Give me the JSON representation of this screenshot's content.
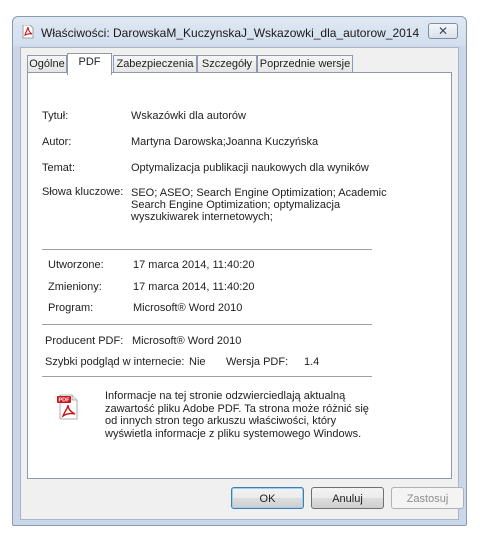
{
  "window": {
    "title": "Właściwości: DarowskaM_KuczynskaJ_Wskazowki_dla_autorow_2014",
    "close_glyph": "✕",
    "icon": "pdf-file-icon"
  },
  "tabs": [
    {
      "label": "Ogólne",
      "active": false
    },
    {
      "label": "PDF",
      "active": true
    },
    {
      "label": "Zabezpieczenia",
      "active": false
    },
    {
      "label": "Szczegóły",
      "active": false
    },
    {
      "label": "Poprzednie wersje",
      "active": false
    }
  ],
  "properties": {
    "title_label": "Tytuł:",
    "title_value": "Wskazówki dla autorów",
    "author_label": "Autor:",
    "author_value": "Martyna Darowska;Joanna Kuczyńska",
    "subject_label": "Temat:",
    "subject_value": "Optymalizacja publikacji naukowych dla wyników",
    "keywords_label": "Słowa kluczowe:",
    "keywords_value": "SEO; ASEO; Search Engine Optimization; Academic Search Engine Optimization; optymalizacja wyszukiwarek internetowych;"
  },
  "dates": {
    "created_label": "Utworzone:",
    "created_value": "17 marca 2014, 11:40:20",
    "modified_label": "Zmieniony:",
    "modified_value": "17 marca 2014, 11:40:20",
    "program_label": "Program:",
    "program_value": "Microsoft® Word 2010"
  },
  "producer": {
    "label": "Producent PDF:",
    "value": "Microsoft® Word 2010",
    "fast_view_label": "Szybki podgląd w internecie:",
    "fast_view_value": "Nie",
    "version_label": "Wersja PDF:",
    "version_value": "1.4"
  },
  "info": {
    "text": "Informacje na tej stronie odzwierciedlają aktualną zawartość pliku Adobe PDF. Ta strona może różnić się od innych stron tego arkuszu właściwości, który wyświetla informacje z pliku systemowego Windows.",
    "icon": "adobe-pdf-icon",
    "icon_badge": "PDF"
  },
  "buttons": {
    "ok": "OK",
    "cancel": "Anuluj",
    "apply": "Zastosuj"
  },
  "colors": {
    "pdf_red": "#c9141a",
    "titlebar": "#d3dfee"
  }
}
